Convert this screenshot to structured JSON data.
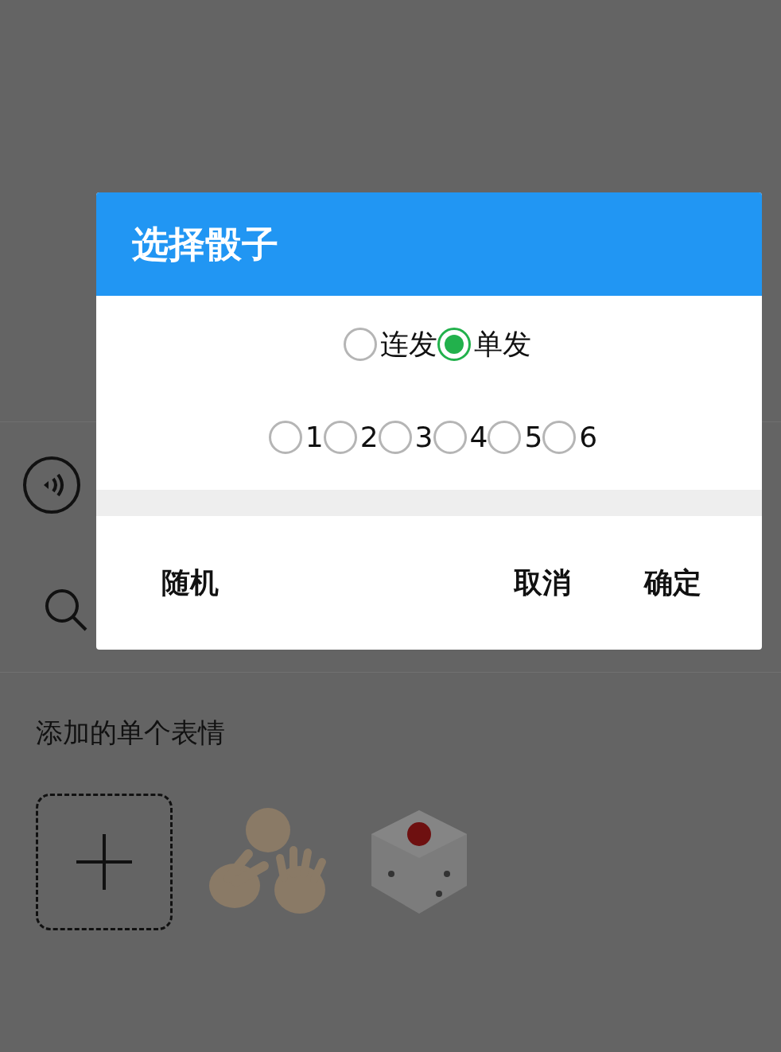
{
  "section": {
    "title": "添加的单个表情"
  },
  "dialog": {
    "title": "选择骰子",
    "modes": [
      {
        "label": "连发",
        "selected": false
      },
      {
        "label": "单发",
        "selected": true
      }
    ],
    "faces": [
      {
        "label": "1",
        "selected": false
      },
      {
        "label": "2",
        "selected": false
      },
      {
        "label": "3",
        "selected": false
      },
      {
        "label": "4",
        "selected": false
      },
      {
        "label": "5",
        "selected": false
      },
      {
        "label": "6",
        "selected": false
      }
    ],
    "left_button": "随机",
    "right_buttons": [
      "取消",
      "确定"
    ]
  }
}
